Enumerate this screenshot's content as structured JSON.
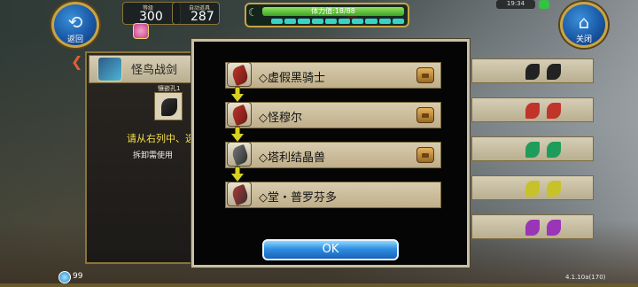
{
  "hud": {
    "back_label": "返回",
    "close_label": "关闭",
    "level_caption": "等级",
    "level_value": "300",
    "money_caption": "自动道具",
    "money_value": "287",
    "stamina_label": "体力值:18/88",
    "clock": "19:34",
    "bottom_count": "99",
    "version": "4.1.10a(170)"
  },
  "background_panel": {
    "item_name": "怪鸟战剑",
    "socket_caption": "镶嵌孔1",
    "hint_line1": "请从右列中、选",
    "hint_line2": "拆卸需使用"
  },
  "dialog": {
    "stages": [
      {
        "name": "◇虚假黑骑士",
        "has_bag": true,
        "claw_color": "#c0342a"
      },
      {
        "name": "◇怪穆尔",
        "has_bag": true,
        "claw_color": "#c0342a"
      },
      {
        "name": "◇塔利结晶兽",
        "has_bag": true,
        "claw_color": "#8a8a8a"
      },
      {
        "name": "◇堂・普罗芬多",
        "has_bag": false,
        "claw_color": "#c0342a"
      }
    ],
    "ok_label": "OK"
  },
  "colors": {
    "accent_gold": "#c9a445",
    "button_blue": "#2f8fe0",
    "hint_yellow": "#f4e04a"
  }
}
